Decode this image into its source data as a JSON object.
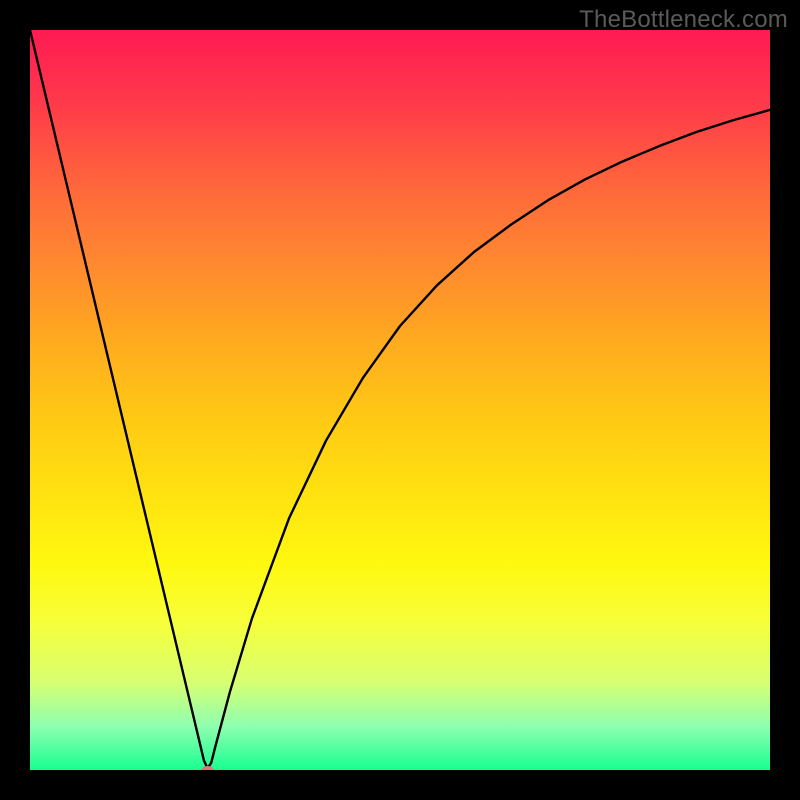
{
  "watermark": "TheBottleneck.com",
  "chart_data": {
    "type": "line",
    "title": "",
    "xlabel": "",
    "ylabel": "",
    "xlim": [
      0,
      100
    ],
    "ylim": [
      0,
      100
    ],
    "grid": false,
    "legend": false,
    "series": [
      {
        "name": "bottleneck-curve",
        "color": "#000000",
        "x": [
          0,
          5,
          10,
          15,
          20,
          22,
          23,
          23.5,
          24,
          24.5,
          25,
          27,
          30,
          35,
          40,
          45,
          50,
          55,
          60,
          65,
          70,
          75,
          80,
          85,
          90,
          95,
          100
        ],
        "y": [
          100,
          79,
          58,
          37,
          16,
          7.6,
          3.4,
          1.3,
          0.2,
          1.0,
          3.0,
          10.5,
          20.5,
          34.0,
          44.5,
          53.0,
          60.0,
          65.5,
          70.0,
          73.7,
          77.0,
          79.8,
          82.2,
          84.3,
          86.2,
          87.8,
          89.2
        ]
      }
    ],
    "marker": {
      "name": "optimum-point",
      "x": 24,
      "y": 0,
      "color": "#d47a7a",
      "rx": 6,
      "ry": 4
    }
  }
}
